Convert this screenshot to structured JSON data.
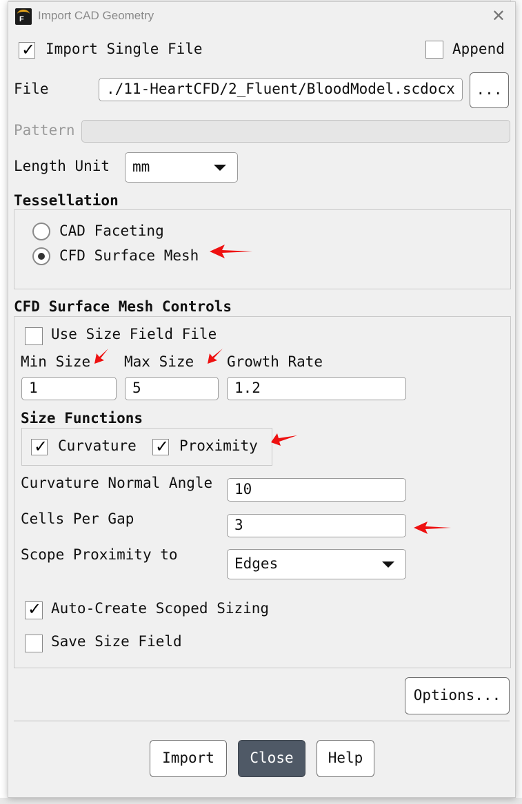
{
  "window": {
    "title": "Import CAD Geometry",
    "icon": "fluent-app-icon",
    "app_icon_letter": "F"
  },
  "import_single_file": {
    "label": "Import Single File",
    "checked": true
  },
  "append": {
    "label": "Append",
    "checked": false
  },
  "file": {
    "label": "File",
    "value": "./11-HeartCFD/2_Fluent/BloodModel.scdocx",
    "browse_label": "..."
  },
  "pattern": {
    "label": "Pattern",
    "value": ""
  },
  "length_unit": {
    "label": "Length Unit",
    "value": "mm"
  },
  "tessellation": {
    "header": "Tessellation",
    "options": [
      {
        "label": "CAD Faceting",
        "selected": false
      },
      {
        "label": "CFD Surface Mesh",
        "selected": true
      }
    ]
  },
  "cfd_controls": {
    "header": "CFD Surface Mesh Controls",
    "use_size_field_file": {
      "label": "Use Size Field File",
      "checked": false
    },
    "min_size": {
      "label": "Min Size",
      "value": "1"
    },
    "max_size": {
      "label": "Max Size",
      "value": "5"
    },
    "growth_rate": {
      "label": "Growth Rate",
      "value": "1.2"
    },
    "size_functions": {
      "header": "Size Functions",
      "curvature": {
        "label": "Curvature",
        "checked": true
      },
      "proximity": {
        "label": "Proximity",
        "checked": true
      }
    },
    "curvature_normal_angle": {
      "label": "Curvature Normal Angle",
      "value": "10"
    },
    "cells_per_gap": {
      "label": "Cells Per Gap",
      "value": "3"
    },
    "scope_proximity": {
      "label": "Scope Proximity to",
      "value": "Edges"
    },
    "auto_create": {
      "label": "Auto-Create Scoped Sizing",
      "checked": true
    },
    "save_size_field": {
      "label": "Save Size Field",
      "checked": false
    }
  },
  "buttons": {
    "options": "Options...",
    "import": "Import",
    "close": "Close",
    "help": "Help"
  },
  "colors": {
    "annotation_arrow": "#ee1111",
    "primary_button": "#4f5966"
  }
}
